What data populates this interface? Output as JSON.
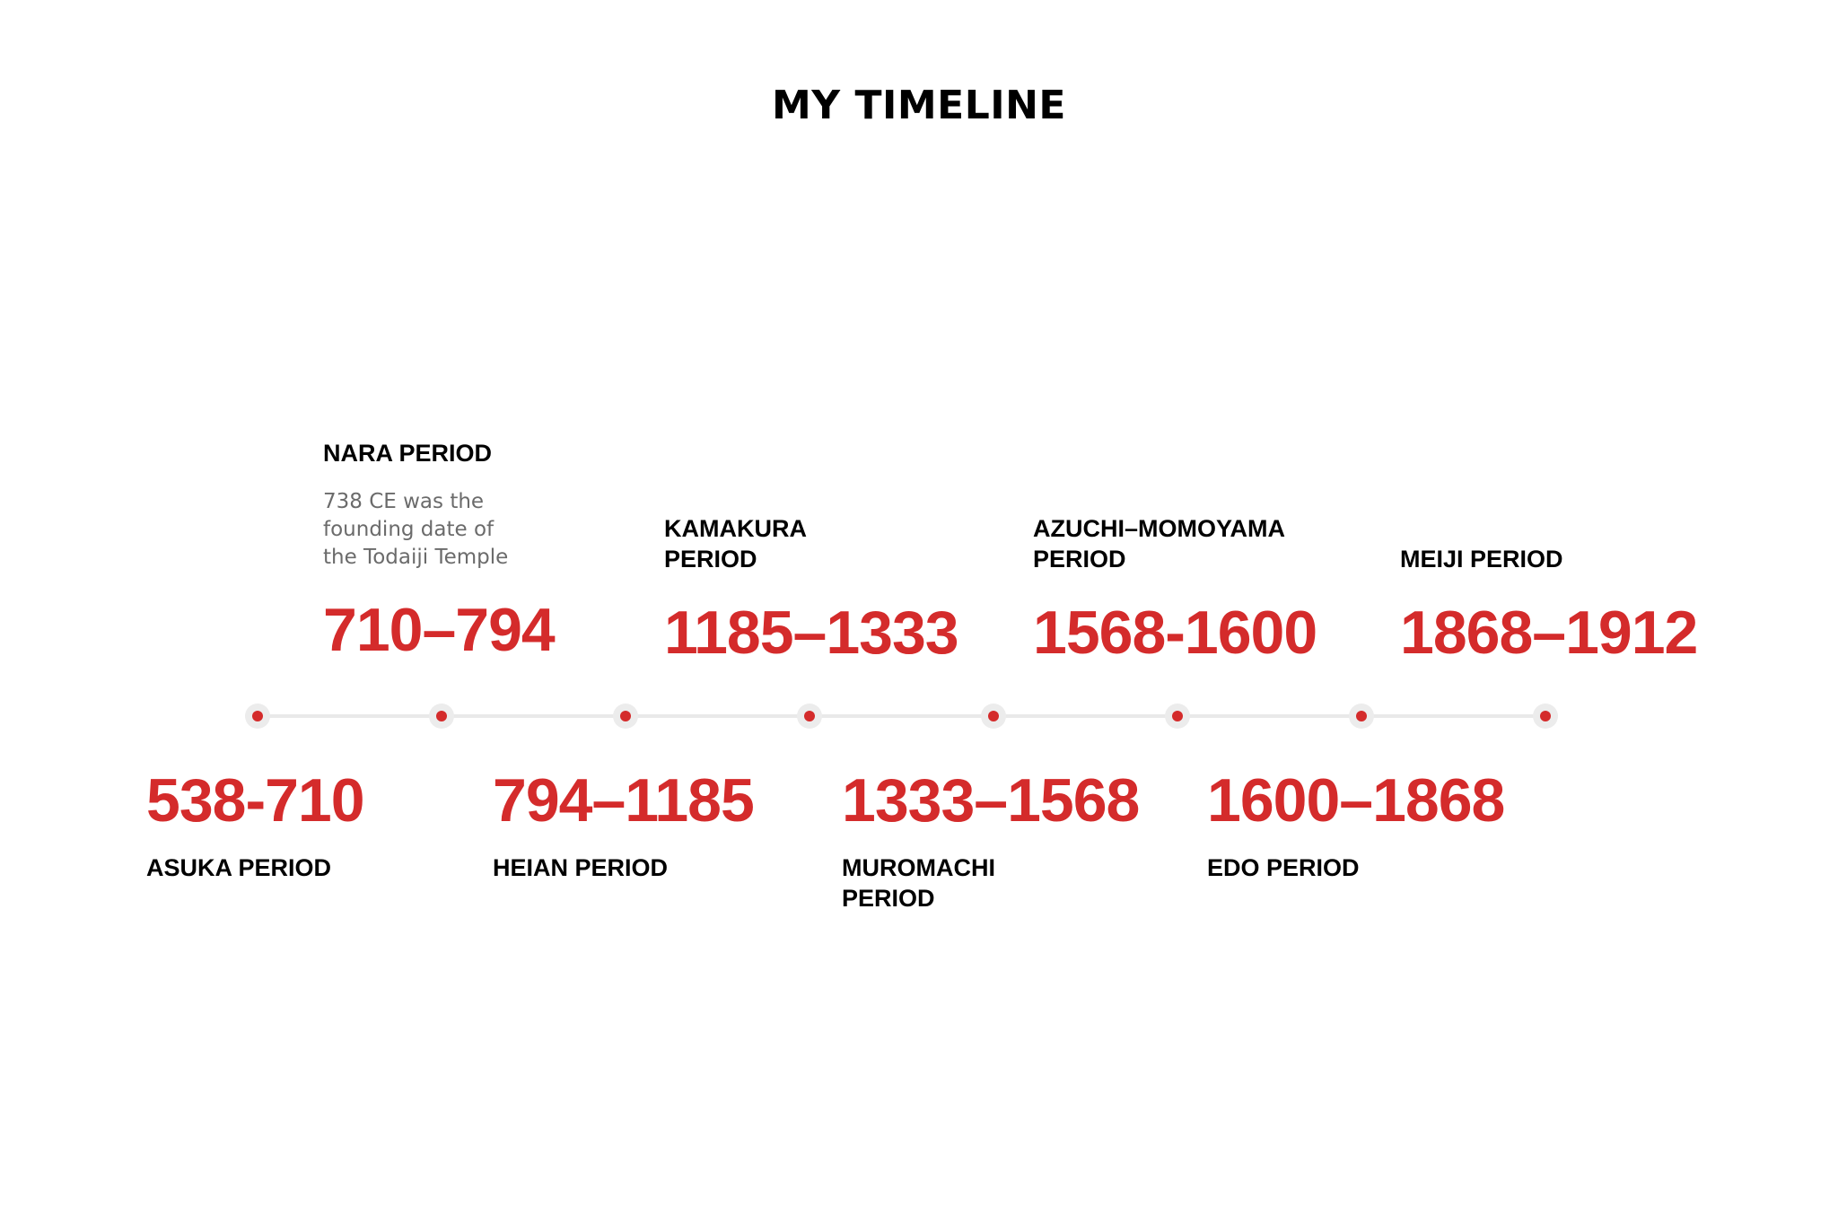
{
  "title": "MY TIMELINE",
  "colors": {
    "accent": "#d42b2b",
    "line": "#e9e9e9",
    "text": "#000000",
    "muted": "#6b6b6b"
  },
  "periods": [
    {
      "range": "538-710",
      "label": "ASUKA PERIOD"
    },
    {
      "range": "710–794",
      "label": "NARA PERIOD",
      "description": "738 CE was the founding date of the Todaiji Temple"
    },
    {
      "range": "794–1185",
      "label": "HEIAN PERIOD"
    },
    {
      "range": "1185–1333",
      "label": "KAMAKURA PERIOD"
    },
    {
      "range": "1333–1568",
      "label": "MUROMACHI PERIOD"
    },
    {
      "range": "1568-1600",
      "label": "AZUCHI–MOMOYAMA PERIOD"
    },
    {
      "range": "1600–1868",
      "label": "EDO PERIOD"
    },
    {
      "range": "1868–1912",
      "label": "MEIJI PERIOD"
    }
  ]
}
